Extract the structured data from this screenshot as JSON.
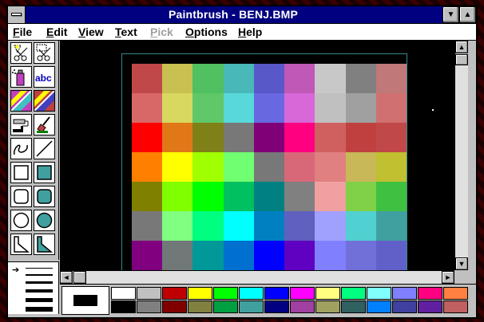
{
  "window": {
    "title": "Paintbrush - BENJ.BMP",
    "minimize_glyph": "▼",
    "maximize_glyph": "▲"
  },
  "menu": [
    {
      "label": "File",
      "underline": "F",
      "rest": "ile",
      "disabled": false
    },
    {
      "label": "Edit",
      "underline": "E",
      "rest": "dit",
      "disabled": false
    },
    {
      "label": "View",
      "underline": "V",
      "rest": "iew",
      "disabled": false
    },
    {
      "label": "Text",
      "underline": "T",
      "rest": "ext",
      "disabled": false
    },
    {
      "label": "Pick",
      "underline": "P",
      "rest": "ick",
      "disabled": true
    },
    {
      "label": "Options",
      "underline": "O",
      "rest": "ptions",
      "disabled": false
    },
    {
      "label": "Help",
      "underline": "H",
      "rest": "elp",
      "disabled": false
    }
  ],
  "tools": [
    {
      "name": "scissors-icon",
      "row": 0,
      "col": 0
    },
    {
      "name": "pick-scissors-icon",
      "row": 0,
      "col": 1
    },
    {
      "name": "airbrush-icon",
      "row": 1,
      "col": 0
    },
    {
      "name": "text-tool-icon",
      "row": 1,
      "col": 1,
      "label": "abc"
    },
    {
      "name": "color-eraser-icon",
      "row": 2,
      "col": 0
    },
    {
      "name": "eraser-icon",
      "row": 2,
      "col": 1
    },
    {
      "name": "paint-roller-icon",
      "row": 3,
      "col": 0
    },
    {
      "name": "brush-icon",
      "row": 3,
      "col": 1
    },
    {
      "name": "curve-icon",
      "row": 4,
      "col": 0
    },
    {
      "name": "line-icon",
      "row": 4,
      "col": 1
    },
    {
      "name": "box-icon",
      "row": 5,
      "col": 0
    },
    {
      "name": "filled-box-icon",
      "row": 5,
      "col": 1
    },
    {
      "name": "rounded-box-icon",
      "row": 6,
      "col": 0
    },
    {
      "name": "filled-rounded-box-icon",
      "row": 6,
      "col": 1
    },
    {
      "name": "circle-icon",
      "row": 7,
      "col": 0
    },
    {
      "name": "filled-circle-icon",
      "row": 7,
      "col": 1
    },
    {
      "name": "polygon-icon",
      "row": 8,
      "col": 0
    },
    {
      "name": "filled-polygon-icon",
      "row": 8,
      "col": 1
    }
  ],
  "line_width": {
    "selected_glyph": "➔"
  },
  "image_grid": [
    [
      "#c04848",
      "#c8c050",
      "#50c060",
      "#48b8b8",
      "#5858c8",
      "#c058b8",
      "#c8c8c8",
      "#808080",
      "#c07878"
    ],
    [
      "#d86868",
      "#d8d860",
      "#60c868",
      "#58d8d8",
      "#6868e0",
      "#d868d8",
      "#c0c0c0",
      "#a0a0a0",
      "#d07070"
    ],
    [
      "#ff0000",
      "#e07818",
      "#808018",
      "#787878",
      "#800078",
      "#ff0080",
      "#d06060",
      "#c04040",
      "#c04848"
    ],
    [
      "#ff8000",
      "#ffff00",
      "#a0ff00",
      "#70ff70",
      "#787878",
      "#d86878",
      "#e08080",
      "#c8b858",
      "#c0c030"
    ],
    [
      "#808000",
      "#80ff00",
      "#00ff00",
      "#00c060",
      "#008080",
      "#808080",
      "#f0a0a0",
      "#80d048",
      "#40c040"
    ],
    [
      "#787878",
      "#80ff80",
      "#00ff80",
      "#00ffff",
      "#0080c0",
      "#6060c0",
      "#a0a0ff",
      "#50d0d0",
      "#40a0a0"
    ],
    [
      "#800080",
      "#707878",
      "#009898",
      "#0070d0",
      "#0000ff",
      "#6000c0",
      "#8080ff",
      "#7070d8",
      "#6060c8"
    ]
  ],
  "palette": {
    "foreground": "#000000",
    "background": "#ffffff",
    "row1": [
      "#ffffff",
      "#c0c0c0",
      "#c00000",
      "#ffff00",
      "#00ff00",
      "#00ffff",
      "#0000ff",
      "#ff00ff",
      "#ffff80",
      "#00ff80",
      "#80ffff",
      "#8080ff",
      "#ff0080",
      "#ff8040"
    ],
    "row2": [
      "#000000",
      "#808080",
      "#800000",
      "#808040",
      "#00a040",
      "#40a0a0",
      "#000080",
      "#a040a0",
      "#a0a060",
      "#306060",
      "#0080ff",
      "#4040a0",
      "#6020a0",
      "#c06060"
    ]
  },
  "scroll": {
    "up_glyph": "▲",
    "down_glyph": "▼",
    "left_glyph": "◄",
    "right_glyph": "►"
  }
}
